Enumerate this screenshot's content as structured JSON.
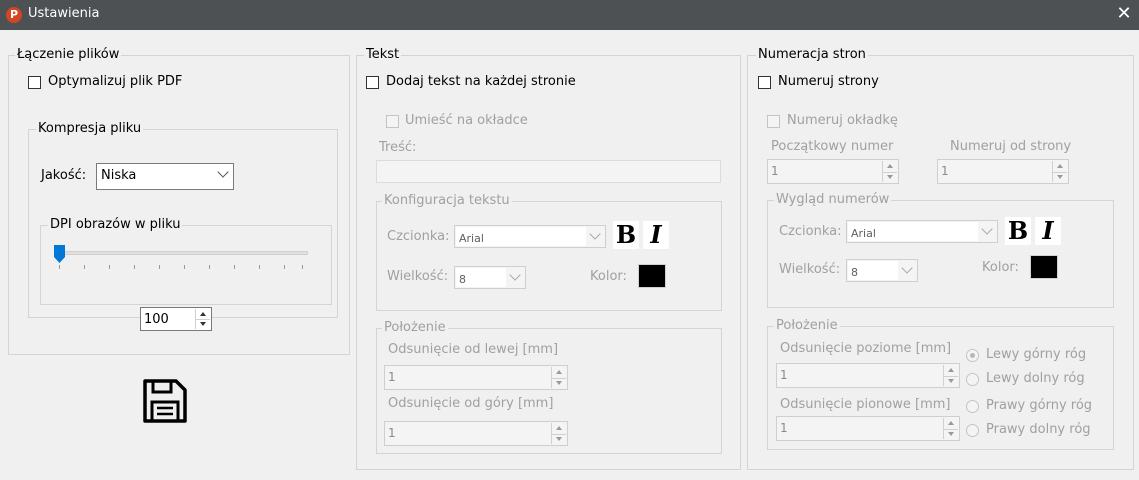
{
  "window": {
    "title": "Ustawienia",
    "app_icon_letter": "P",
    "close_glyph": "✕"
  },
  "merge": {
    "legend": "Łączenie plików",
    "optimize_label": "Optymalizuj plik PDF",
    "compression": {
      "legend": "Kompresja pliku",
      "quality_label": "Jakość:",
      "quality_value": "Niska",
      "dpi_legend": "DPI obrazów w pliku",
      "dpi_slider_position": 0,
      "dpi_value": "100"
    },
    "save_icon": "save-icon"
  },
  "text": {
    "legend": "Tekst",
    "add_text_label": "Dodaj tekst na każdej stronie",
    "cover_label": "Umieść na okładce",
    "content_label": "Treść:",
    "content_value": "",
    "config": {
      "legend": "Konfiguracja tekstu",
      "font_label": "Czcionka:",
      "font_value": "Arial",
      "bold": "B",
      "italic": "I",
      "size_label": "Wielkość:",
      "size_value": "8",
      "color_label": "Kolor:",
      "color_value": "#000000"
    },
    "position": {
      "legend": "Położenie",
      "left_label": "Odsunięcie od lewej [mm]",
      "left_value": "1",
      "top_label": "Odsunięcie od góry [mm]",
      "top_value": "1"
    }
  },
  "numbering": {
    "legend": "Numeracja stron",
    "enable_label": "Numeruj strony",
    "cover_label": "Numeruj okładkę",
    "start_label": "Początkowy numer",
    "start_value": "1",
    "from_page_label": "Numeruj od strony",
    "from_page_value": "1",
    "look": {
      "legend": "Wygląd numerów",
      "font_label": "Czcionka:",
      "font_value": "Arial",
      "bold": "B",
      "italic": "I",
      "size_label": "Wielkość:",
      "size_value": "8",
      "color_label": "Kolor:",
      "color_value": "#000000"
    },
    "position": {
      "legend": "Położenie",
      "horizontal_label": "Odsunięcie poziome [mm]",
      "horizontal_value": "1",
      "vertical_label": "Odsunięcie pionowe [mm]",
      "vertical_value": "1",
      "corners": [
        "Lewy górny róg",
        "Lewy dolny róg",
        "Prawy górny róg",
        "Prawy dolny róg"
      ],
      "selected_corner": "Lewy górny róg"
    }
  }
}
